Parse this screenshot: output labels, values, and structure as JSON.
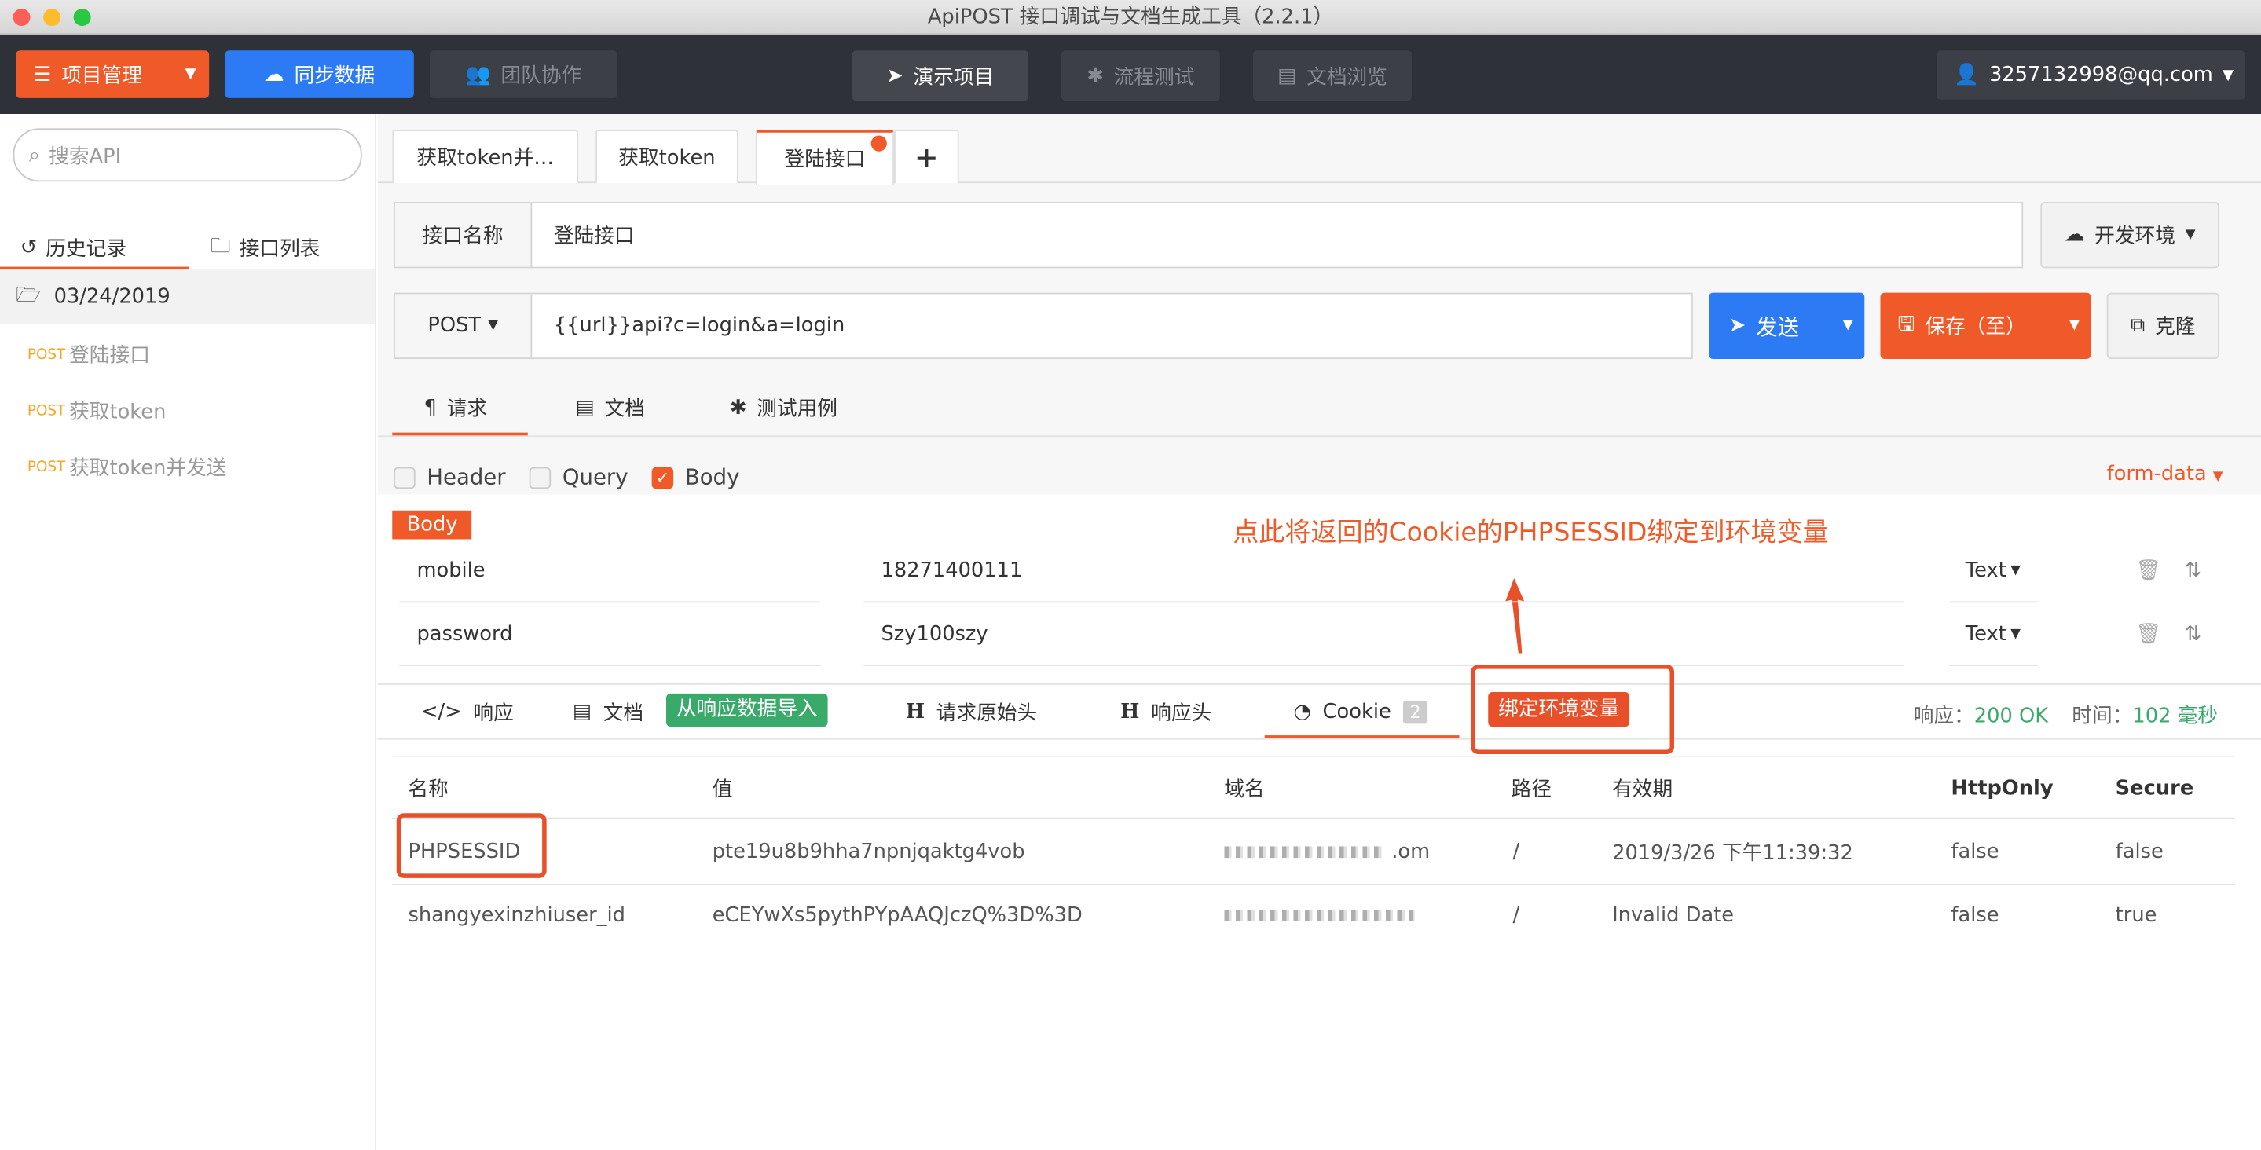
{
  "window": {
    "title": "ApiPOST 接口调试与文档生成工具（2.2.1）"
  },
  "topnav": {
    "project_mgmt": "项目管理",
    "sync": "同步数据",
    "team": "团队协作",
    "demo": "演示项目",
    "flow_test": "流程测试",
    "doc_browse": "文档浏览",
    "user": "3257132998@qq.com"
  },
  "sidebar": {
    "search_placeholder": "搜索API",
    "tab_history": "历史记录",
    "tab_api_list": "接口列表",
    "date_group": "03/24/2019",
    "items": [
      {
        "method": "POST",
        "name": "登陆接口"
      },
      {
        "method": "POST",
        "name": "获取token"
      },
      {
        "method": "POST",
        "name": "获取token并发送"
      }
    ]
  },
  "tabs": [
    "获取token并…",
    "获取token",
    "登陆接口"
  ],
  "api": {
    "name_label": "接口名称",
    "name_value": "登陆接口",
    "env": "开发环境",
    "method": "POST",
    "url": "{{url}}api?c=login&a=login",
    "send": "发送",
    "save": "保存（至）",
    "clone": "克隆"
  },
  "request_tabs": {
    "request": "请求",
    "doc": "文档",
    "test": "测试用例"
  },
  "body_options": {
    "header": "Header",
    "query": "Query",
    "body": "Body",
    "form_type": "form-data",
    "body_tag": "Body"
  },
  "params": [
    {
      "key": "mobile",
      "value": "18271400111",
      "type": "Text"
    },
    {
      "key": "password",
      "value": "Szy100szy",
      "type": "Text"
    }
  ],
  "annotation": "点此将返回的Cookie的PHPSESSID绑定到环境变量",
  "response_tabs": {
    "response": "响应",
    "doc": "文档",
    "import": "从响应数据导入",
    "raw_headers": "请求原始头",
    "resp_headers": "响应头",
    "cookie": "Cookie",
    "cookie_count": "2",
    "bind_env": "绑定环境变量"
  },
  "status": {
    "resp_label": "响应：",
    "resp_value": "200 OK",
    "time_label": "时间：",
    "time_value": "102 毫秒"
  },
  "cookie_table": {
    "headers": [
      "名称",
      "值",
      "域名",
      "路径",
      "有效期",
      "HttpOnly",
      "Secure"
    ],
    "rows": [
      {
        "name": "PHPSESSID",
        "value": "pte19u8b9hha7npnjqaktg4vob",
        "domain": ".om",
        "path": "/",
        "expires": "2019/3/26 下午11:39:32",
        "httponly": "false",
        "secure": "false"
      },
      {
        "name": "shangyexinzhiuser_id",
        "value": "eCEYwXs5pythPYpAAQJczQ%3D%3D",
        "domain": "",
        "path": "/",
        "expires": "Invalid Date",
        "httponly": "false",
        "secure": "true"
      }
    ]
  },
  "colors": {
    "orange": "#f05a28",
    "blue": "#2d7bf4",
    "green": "#3aaa6a",
    "dark": "#2f3138"
  }
}
